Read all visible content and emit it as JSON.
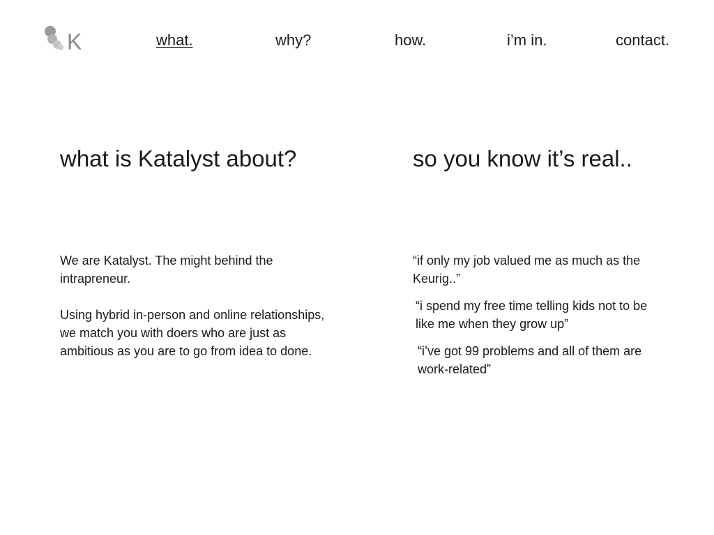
{
  "brand": {
    "logo_letter": "K",
    "logo_color": "#888888"
  },
  "nav": {
    "items": [
      {
        "label": "what.",
        "active": true
      },
      {
        "label": "why?",
        "active": false
      },
      {
        "label": "how.",
        "active": false
      },
      {
        "label": "i’m in.",
        "active": false
      },
      {
        "label": "contact.",
        "active": false
      }
    ]
  },
  "about": {
    "heading": "what is Katalyst about?",
    "paragraphs": [
      "We are Katalyst. The might behind the intrapreneur.",
      "Using hybrid in-person and online relationships, we match you with doers who are just as ambitious as you are to go from idea to done."
    ]
  },
  "testimonials": {
    "heading": "so you know it’s real..",
    "quotes": [
      "“if only my job valued me as much as the Keurig..”",
      "“i spend my free time telling kids not to be like me when they grow up”",
      "“i’ve got 99 problems and all of them are work-related”"
    ]
  }
}
